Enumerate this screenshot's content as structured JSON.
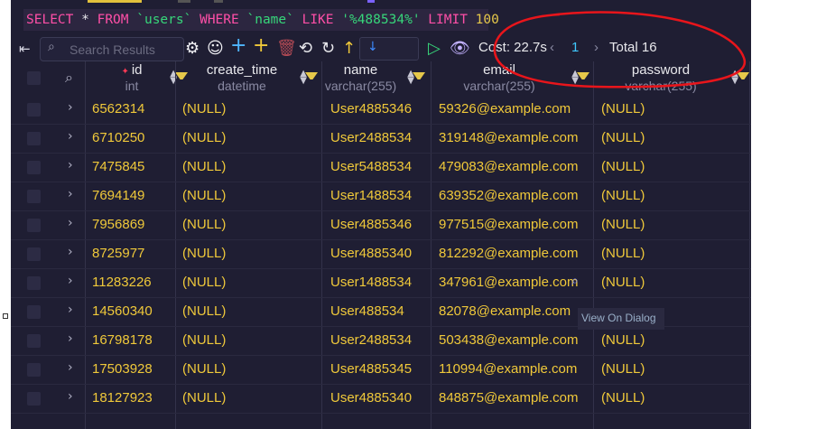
{
  "sql": {
    "kw_select": "SELECT",
    "star": " * ",
    "kw_from": "FROM",
    "table": " `users` ",
    "kw_where": "WHERE",
    "column": " `name` ",
    "kw_like": "LIKE",
    "pattern": " '%488534%' ",
    "kw_limit": "LIMIT",
    "limit": " 100"
  },
  "toolbar": {
    "search_placeholder": "Search Results",
    "cost": "Cost: 22.7s",
    "page": "1",
    "total": "Total 16",
    "icons": [
      "pin-icon",
      "gear-icon",
      "user-circle-icon",
      "plus-icon",
      "plus-alt-icon",
      "trash-icon",
      "refresh-icon",
      "redo-icon",
      "up-arrow-icon",
      "down-arrow-icon",
      "play-icon",
      "eye-icon"
    ]
  },
  "columns": [
    {
      "name": "id",
      "type": "int",
      "primary": true
    },
    {
      "name": "create_time",
      "type": "datetime"
    },
    {
      "name": "name",
      "type": "varchar(255)"
    },
    {
      "name": "email",
      "type": "varchar(255)"
    },
    {
      "name": "password",
      "type": "varchar(255)"
    }
  ],
  "rows": [
    {
      "id": "6562314",
      "create_time": "(NULL)",
      "name": "User4885346",
      "email": "59326@example.com",
      "password": "(NULL)"
    },
    {
      "id": "6710250",
      "create_time": "(NULL)",
      "name": "User2488534",
      "email": "319148@example.com",
      "password": "(NULL)"
    },
    {
      "id": "7475845",
      "create_time": "(NULL)",
      "name": "User5488534",
      "email": "479083@example.com",
      "password": "(NULL)"
    },
    {
      "id": "7694149",
      "create_time": "(NULL)",
      "name": "User1488534",
      "email": "639352@example.com",
      "password": "(NULL)"
    },
    {
      "id": "7956869",
      "create_time": "(NULL)",
      "name": "User4885346",
      "email": "977515@example.com",
      "password": "(NULL)"
    },
    {
      "id": "8725977",
      "create_time": "(NULL)",
      "name": "User4885340",
      "email": "812292@example.com",
      "password": "(NULL)"
    },
    {
      "id": "11283226",
      "create_time": "(NULL)",
      "name": "User1488534",
      "email": "347961@example.com",
      "password": "(NULL)"
    },
    {
      "id": "14560340",
      "create_time": "(NULL)",
      "name": "User488534",
      "email": "82078@example.com",
      "password": ""
    },
    {
      "id": "16798178",
      "create_time": "(NULL)",
      "name": "User2488534",
      "email": "503438@example.com",
      "password": "(NULL)"
    },
    {
      "id": "17503928",
      "create_time": "(NULL)",
      "name": "User4885345",
      "email": "110994@example.com",
      "password": "(NULL)"
    },
    {
      "id": "18127923",
      "create_time": "(NULL)",
      "name": "User4885340",
      "email": "848875@example.com",
      "password": "(NULL)"
    }
  ],
  "tooltip": "View On Dialog",
  "colors": {
    "value": "#f0c93a",
    "keyword": "#ff4fa7",
    "string": "#37d67a",
    "annotation": "#e8151b",
    "accent": "#3d8bff"
  }
}
